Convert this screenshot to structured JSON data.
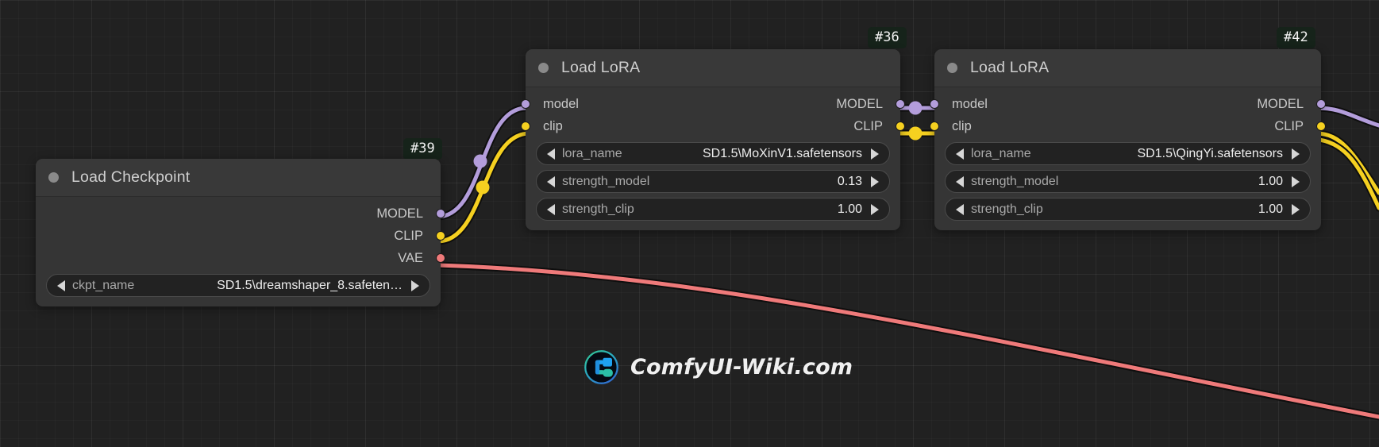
{
  "canvas": {
    "background_color": "#212121",
    "grid_color": "#2b2b2b"
  },
  "link_colors": {
    "MODEL": "#b39ddb",
    "CLIP": "#f5d020",
    "VAE": "#ef7a7a"
  },
  "watermark": {
    "text": "ComfyUI-Wiki.com",
    "logo_name": "comfyui-wiki-logo",
    "ring_color_top": "#2fbf9b",
    "ring_color_bottom": "#2f7fd6",
    "glyph_blue": "#1fa2f0",
    "glyph_teal": "#2bbfa6"
  },
  "nodes": [
    {
      "id_badge": "#39",
      "title": "Load Checkpoint",
      "inputs": [],
      "outputs": [
        {
          "label": "MODEL",
          "color": "#b39ddb"
        },
        {
          "label": "CLIP",
          "color": "#f5d020"
        },
        {
          "label": "VAE",
          "color": "#ef7a7a"
        }
      ],
      "widgets": [
        {
          "name": "ckpt_name",
          "value": "SD1.5\\dreamshaper_8.safeten…"
        }
      ]
    },
    {
      "id_badge": "#36",
      "title": "Load LoRA",
      "inputs": [
        {
          "label": "model",
          "color": "#b39ddb"
        },
        {
          "label": "clip",
          "color": "#f5d020"
        }
      ],
      "outputs": [
        {
          "label": "MODEL",
          "color": "#b39ddb"
        },
        {
          "label": "CLIP",
          "color": "#f5d020"
        }
      ],
      "widgets": [
        {
          "name": "lora_name",
          "value": "SD1.5\\MoXinV1.safetensors"
        },
        {
          "name": "strength_model",
          "value": "0.13"
        },
        {
          "name": "strength_clip",
          "value": "1.00"
        }
      ]
    },
    {
      "id_badge": "#42",
      "title": "Load LoRA",
      "inputs": [
        {
          "label": "model",
          "color": "#b39ddb"
        },
        {
          "label": "clip",
          "color": "#f5d020"
        }
      ],
      "outputs": [
        {
          "label": "MODEL",
          "color": "#b39ddb"
        },
        {
          "label": "CLIP",
          "color": "#f5d020"
        }
      ],
      "widgets": [
        {
          "name": "lora_name",
          "value": "SD1.5\\QingYi.safetensors"
        },
        {
          "name": "strength_model",
          "value": "1.00"
        },
        {
          "name": "strength_clip",
          "value": "1.00"
        }
      ]
    }
  ]
}
